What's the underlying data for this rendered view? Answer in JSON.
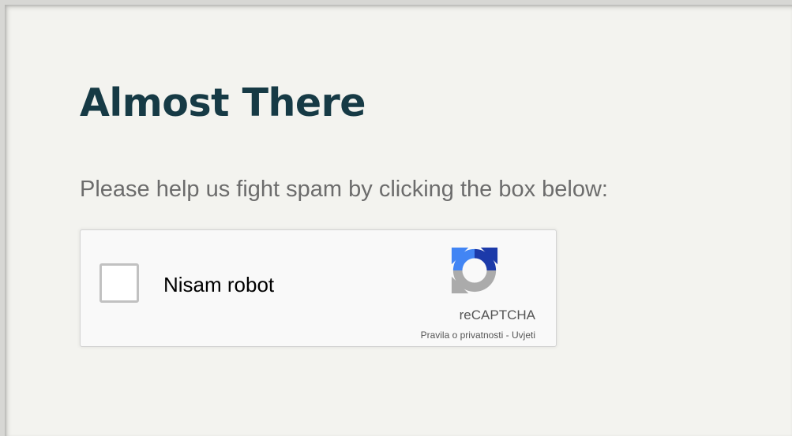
{
  "page": {
    "title": "Almost There",
    "subtitle": "Please help us fight spam by clicking the box below:"
  },
  "recaptcha": {
    "checkbox_label": "Nisam robot",
    "brand": "reCAPTCHA",
    "privacy_link": "Pravila o privatnosti",
    "separator": " - ",
    "terms_link": "Uvjeti",
    "logo_icon": "recaptcha-logo-icon",
    "checked": false
  },
  "colors": {
    "background": "#f3f3ef",
    "title": "#163a45",
    "subtitle": "#6c6c6c",
    "widget_bg": "#f9f9f9",
    "logo_blue_dark": "#1c3aa9",
    "logo_blue_light": "#4285f4",
    "logo_gray": "#ababab"
  }
}
